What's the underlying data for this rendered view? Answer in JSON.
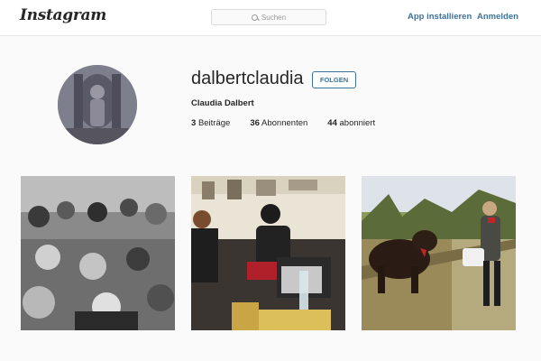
{
  "header": {
    "logo_text": "Instagram",
    "search_placeholder": "Suchen",
    "install_label": "App installieren",
    "login_label": "Anmelden"
  },
  "profile": {
    "username": "dalbertclaudia",
    "follow_label": "FOLGEN",
    "full_name": "Claudia Dalbert",
    "stats": [
      {
        "count": "3",
        "label": "Beiträge"
      },
      {
        "count": "36",
        "label": "Abonnenten"
      },
      {
        "count": "44",
        "label": "abonniert"
      }
    ]
  },
  "posts": [
    {
      "kind": "black-and-white audience photo"
    },
    {
      "kind": "panel discussion photo"
    },
    {
      "kind": "woman with cow outdoors photo"
    }
  ],
  "colors": {
    "link": "#3f729b",
    "text": "#262626",
    "background": "#fafafa"
  }
}
